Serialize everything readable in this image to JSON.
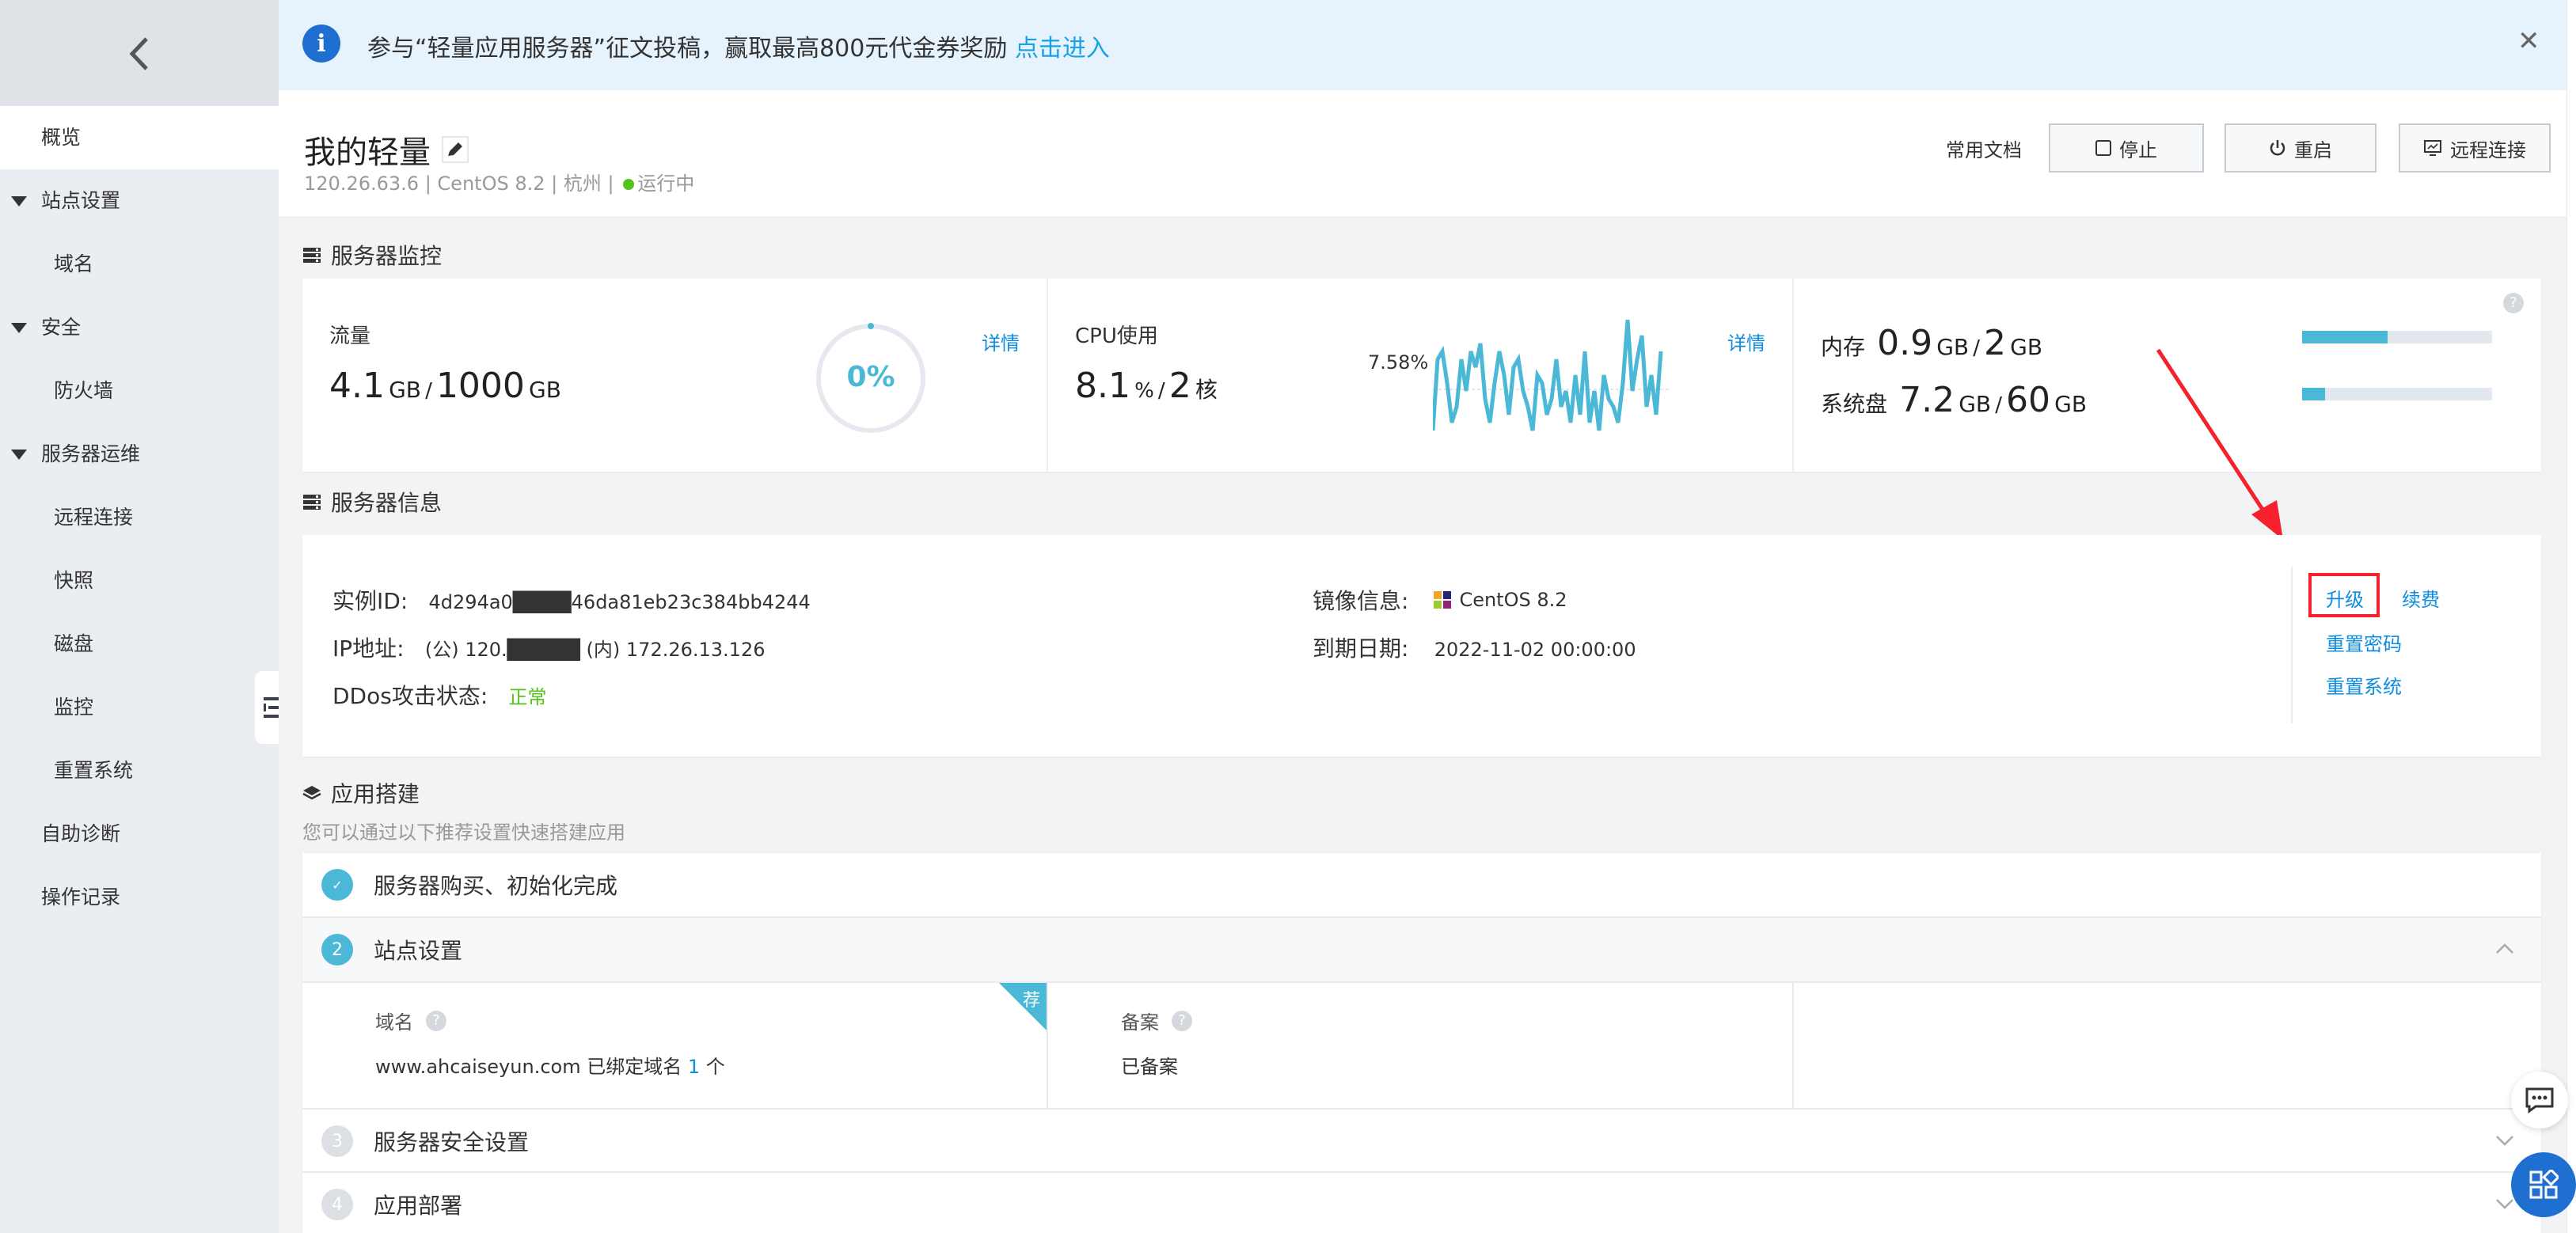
{
  "sidebar": {
    "back_label": "<",
    "items": [
      {
        "label": "概览",
        "type": "active"
      },
      {
        "label": "站点设置",
        "type": "group"
      },
      {
        "label": "域名",
        "type": "sub"
      },
      {
        "label": "安全",
        "type": "group"
      },
      {
        "label": "防火墙",
        "type": "sub"
      },
      {
        "label": "服务器运维",
        "type": "group"
      },
      {
        "label": "远程连接",
        "type": "sub"
      },
      {
        "label": "快照",
        "type": "sub"
      },
      {
        "label": "磁盘",
        "type": "sub"
      },
      {
        "label": "监控",
        "type": "sub"
      },
      {
        "label": "重置系统",
        "type": "sub"
      },
      {
        "label": "自助诊断",
        "type": "top"
      },
      {
        "label": "操作记录",
        "type": "top"
      }
    ]
  },
  "notice": {
    "text": "参与“轻量应用服务器”征文投稿，赢取最高800元代金券奖励",
    "link": "点击进入",
    "close": "✕"
  },
  "header": {
    "title": "我的轻量",
    "ip": "120.26.63.6",
    "os": "CentOS  8.2",
    "region": "杭州",
    "status": "运行中",
    "sep": "|",
    "docs_label": "常用文档",
    "stop_label": "停止",
    "restart_label": "重启",
    "remote_label": "远程连接"
  },
  "monitor": {
    "title": "服务器监控",
    "traffic": {
      "label": "流量",
      "used": "4.1",
      "used_unit": "GB",
      "slash": "/",
      "total": "1000",
      "total_unit": "GB",
      "percent": "0%",
      "percent_value": 0,
      "detail": "详情"
    },
    "cpu": {
      "label": "CPU使用",
      "used": "8.1",
      "used_unit": "%",
      "slash": "/",
      "cores": "2",
      "cores_unit": "核",
      "spark_label": "7.58%",
      "detail": "详情"
    },
    "memory": {
      "label": "内存",
      "used": "0.9",
      "used_unit": "GB",
      "slash": "/",
      "total": "2",
      "total_unit": "GB",
      "fraction": 0.45
    },
    "disk": {
      "label": "系统盘",
      "used": "7.2",
      "used_unit": "GB",
      "slash": "/",
      "total": "60",
      "total_unit": "GB",
      "fraction": 0.12
    },
    "help": "?"
  },
  "info": {
    "title": "服务器信息",
    "instance_label": "实例ID:",
    "instance_value": "4d294a0████46da81eb23c384bb4244",
    "ip_label": "IP地址:",
    "ip_value": "(公) 120.█████  (内) 172.26.13.126",
    "ddos_label": "DDos攻击状态:",
    "ddos_value": "正常",
    "image_label": "镜像信息:",
    "image_value": "CentOS 8.2",
    "expire_label": "到期日期:",
    "expire_value": "2022-11-02 00:00:00",
    "upgrade": "升级",
    "renew": "续费",
    "reset_pwd": "重置密码",
    "reset_sys": "重置系统"
  },
  "app": {
    "title": "应用搭建",
    "subtitle": "您可以通过以下推荐设置快速搭建应用",
    "steps": [
      {
        "num": "✓",
        "label": "服务器购买、初始化完成"
      },
      {
        "num": "2",
        "label": "站点设置"
      },
      {
        "num": "3",
        "label": "服务器安全设置"
      },
      {
        "num": "4",
        "label": "应用部署"
      }
    ],
    "domain_label": "域名",
    "domain_value": "www.ahcaiseyun.com 已绑定域名",
    "domain_count": "1",
    "domain_unit": "个",
    "recommend": "荐",
    "beian_label": "备案",
    "beian_value": "已备案"
  },
  "colors": {
    "accent": "#0c8de0",
    "teal": "#4ab8d6",
    "green": "#52c41a",
    "red": "#f5222d"
  }
}
